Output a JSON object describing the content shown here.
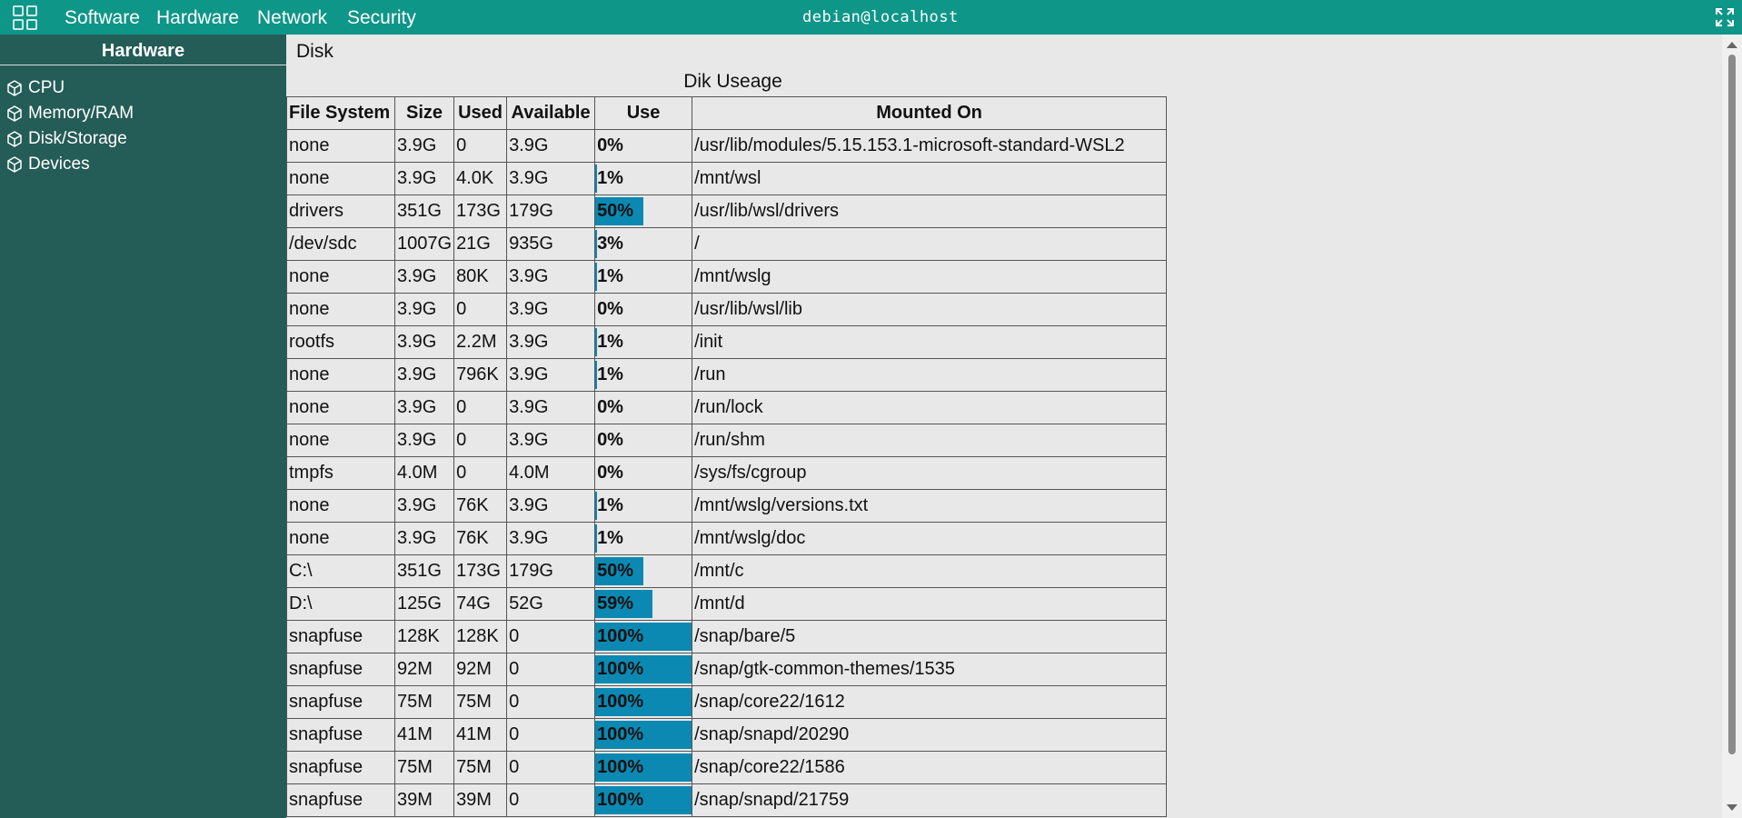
{
  "topbar": {
    "app_icon": "grid-icon",
    "nav": [
      "Software",
      "Hardware",
      "Network",
      "Security"
    ],
    "title": "debian@localhost",
    "fullscreen_icon": "fullscreen-icon"
  },
  "sidebar": {
    "header": "Hardware",
    "items": [
      {
        "label": "CPU",
        "icon": "cube-icon"
      },
      {
        "label": "Memory/RAM",
        "icon": "cube-icon"
      },
      {
        "label": "Disk/Storage",
        "icon": "cube-icon"
      },
      {
        "label": "Devices",
        "icon": "cube-icon"
      }
    ]
  },
  "main": {
    "section_title": "Disk",
    "table_caption": "Dik Useage",
    "columns": [
      "File System",
      "Size",
      "Used",
      "Available",
      "Use",
      "Mounted On"
    ],
    "rows": [
      {
        "fs": "none",
        "size": "3.9G",
        "used": "0",
        "avail": "3.9G",
        "use": "0%",
        "use_pct": 0,
        "mount": "/usr/lib/modules/5.15.153.1-microsoft-standard-WSL2"
      },
      {
        "fs": "none",
        "size": "3.9G",
        "used": "4.0K",
        "avail": "3.9G",
        "use": "1%",
        "use_pct": 1,
        "mount": "/mnt/wsl"
      },
      {
        "fs": "drivers",
        "size": "351G",
        "used": "173G",
        "avail": "179G",
        "use": "50%",
        "use_pct": 50,
        "mount": "/usr/lib/wsl/drivers"
      },
      {
        "fs": "/dev/sdc",
        "size": "1007G",
        "used": "21G",
        "avail": "935G",
        "use": "3%",
        "use_pct": 3,
        "mount": "/"
      },
      {
        "fs": "none",
        "size": "3.9G",
        "used": "80K",
        "avail": "3.9G",
        "use": "1%",
        "use_pct": 1,
        "mount": "/mnt/wslg"
      },
      {
        "fs": "none",
        "size": "3.9G",
        "used": "0",
        "avail": "3.9G",
        "use": "0%",
        "use_pct": 0,
        "mount": "/usr/lib/wsl/lib"
      },
      {
        "fs": "rootfs",
        "size": "3.9G",
        "used": "2.2M",
        "avail": "3.9G",
        "use": "1%",
        "use_pct": 1,
        "mount": "/init"
      },
      {
        "fs": "none",
        "size": "3.9G",
        "used": "796K",
        "avail": "3.9G",
        "use": "1%",
        "use_pct": 1,
        "mount": "/run"
      },
      {
        "fs": "none",
        "size": "3.9G",
        "used": "0",
        "avail": "3.9G",
        "use": "0%",
        "use_pct": 0,
        "mount": "/run/lock"
      },
      {
        "fs": "none",
        "size": "3.9G",
        "used": "0",
        "avail": "3.9G",
        "use": "0%",
        "use_pct": 0,
        "mount": "/run/shm"
      },
      {
        "fs": "tmpfs",
        "size": "4.0M",
        "used": "0",
        "avail": "4.0M",
        "use": "0%",
        "use_pct": 0,
        "mount": "/sys/fs/cgroup"
      },
      {
        "fs": "none",
        "size": "3.9G",
        "used": "76K",
        "avail": "3.9G",
        "use": "1%",
        "use_pct": 1,
        "mount": "/mnt/wslg/versions.txt"
      },
      {
        "fs": "none",
        "size": "3.9G",
        "used": "76K",
        "avail": "3.9G",
        "use": "1%",
        "use_pct": 1,
        "mount": "/mnt/wslg/doc"
      },
      {
        "fs": "C:\\",
        "size": "351G",
        "used": "173G",
        "avail": "179G",
        "use": "50%",
        "use_pct": 50,
        "mount": "/mnt/c"
      },
      {
        "fs": "D:\\",
        "size": "125G",
        "used": "74G",
        "avail": "52G",
        "use": "59%",
        "use_pct": 59,
        "mount": "/mnt/d"
      },
      {
        "fs": "snapfuse",
        "size": "128K",
        "used": "128K",
        "avail": "0",
        "use": "100%",
        "use_pct": 100,
        "mount": "/snap/bare/5"
      },
      {
        "fs": "snapfuse",
        "size": "92M",
        "used": "92M",
        "avail": "0",
        "use": "100%",
        "use_pct": 100,
        "mount": "/snap/gtk-common-themes/1535"
      },
      {
        "fs": "snapfuse",
        "size": "75M",
        "used": "75M",
        "avail": "0",
        "use": "100%",
        "use_pct": 100,
        "mount": "/snap/core22/1612"
      },
      {
        "fs": "snapfuse",
        "size": "41M",
        "used": "41M",
        "avail": "0",
        "use": "100%",
        "use_pct": 100,
        "mount": "/snap/snapd/20290"
      },
      {
        "fs": "snapfuse",
        "size": "75M",
        "used": "75M",
        "avail": "0",
        "use": "100%",
        "use_pct": 100,
        "mount": "/snap/core22/1586"
      },
      {
        "fs": "snapfuse",
        "size": "39M",
        "used": "39M",
        "avail": "0",
        "use": "100%",
        "use_pct": 100,
        "mount": "/snap/snapd/21759"
      }
    ]
  },
  "colors": {
    "topbar": "#0e9688",
    "sidebar": "#245c57",
    "use_bar": "#0b89b2",
    "background": "#e8e8e8"
  }
}
